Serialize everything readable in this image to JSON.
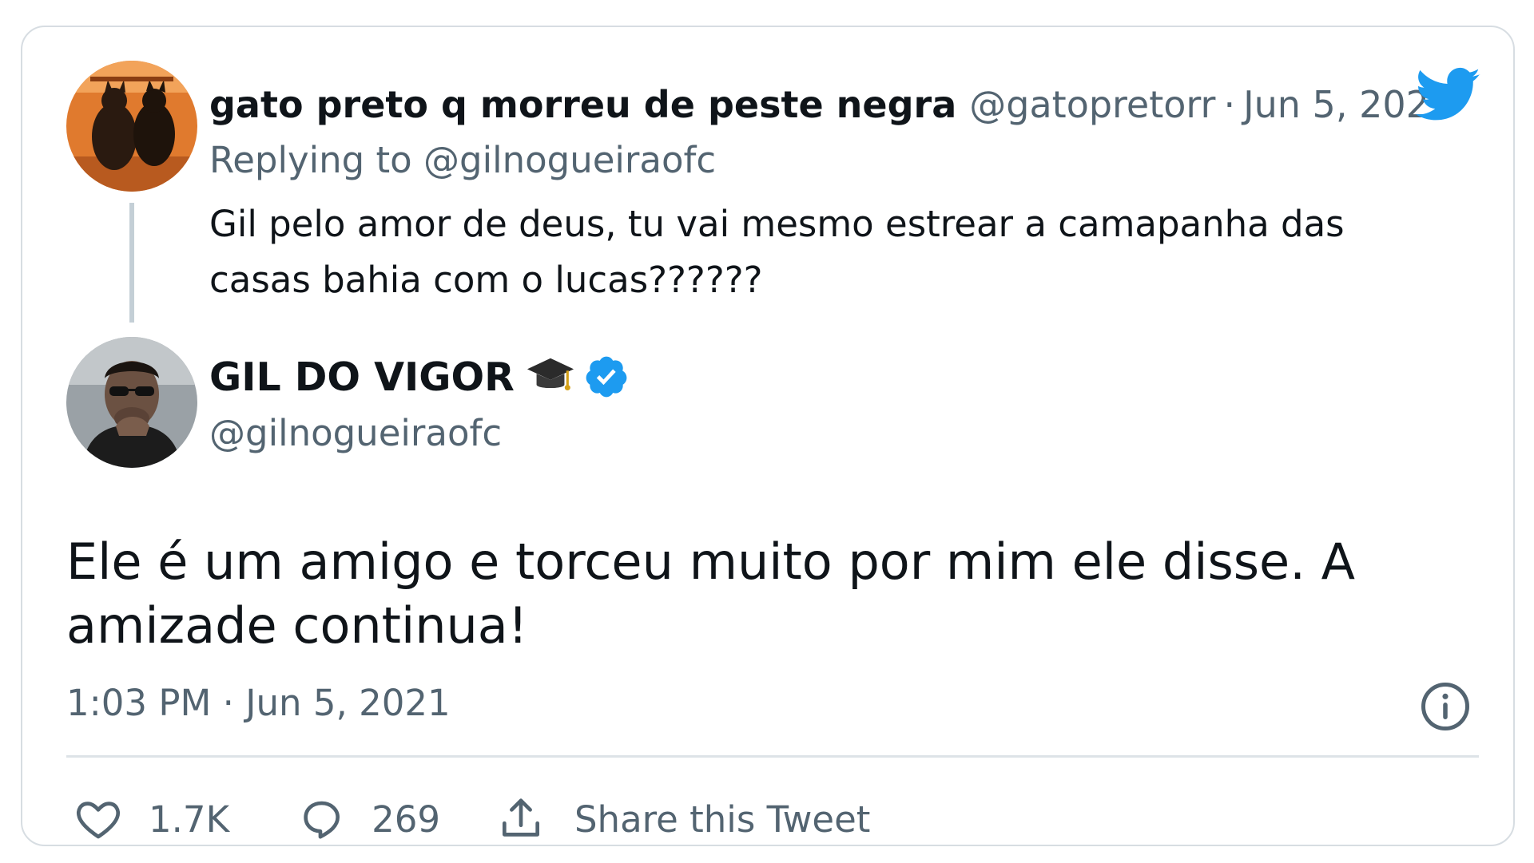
{
  "replied_tweet": {
    "display_name": "gato preto q morreu de peste negra",
    "handle": "@gatopretorr",
    "separator": "·",
    "date": "Jun 5, 2021",
    "replying_prefix": "Replying to",
    "replying_to": "@gilnogueiraofc",
    "text": "Gil pelo amor de deus, tu vai mesmo estrear a camapanha das casas bahia com o lucas??????",
    "avatar_icon": "cat-photo-avatar"
  },
  "main_tweet": {
    "display_name": "GIL DO VIGOR",
    "name_emoji_icon": "graduation-cap-icon",
    "verified_icon": "verified-badge-icon",
    "handle": "@gilnogueiraofc",
    "text": "Ele é um amigo e torceu muito por mim ele disse. A amizade continua!",
    "time": "1:03 PM",
    "separator": "·",
    "date": "Jun 5, 2021",
    "avatar_icon": "man-portrait-avatar"
  },
  "actions": {
    "like_count": "1.7K",
    "reply_count": "269",
    "share_label": "Share this Tweet"
  },
  "colors": {
    "twitter_blue": "#1d9bf0",
    "secondary_text": "#536471",
    "primary_text": "#0f1419",
    "border": "#d7dde2"
  }
}
